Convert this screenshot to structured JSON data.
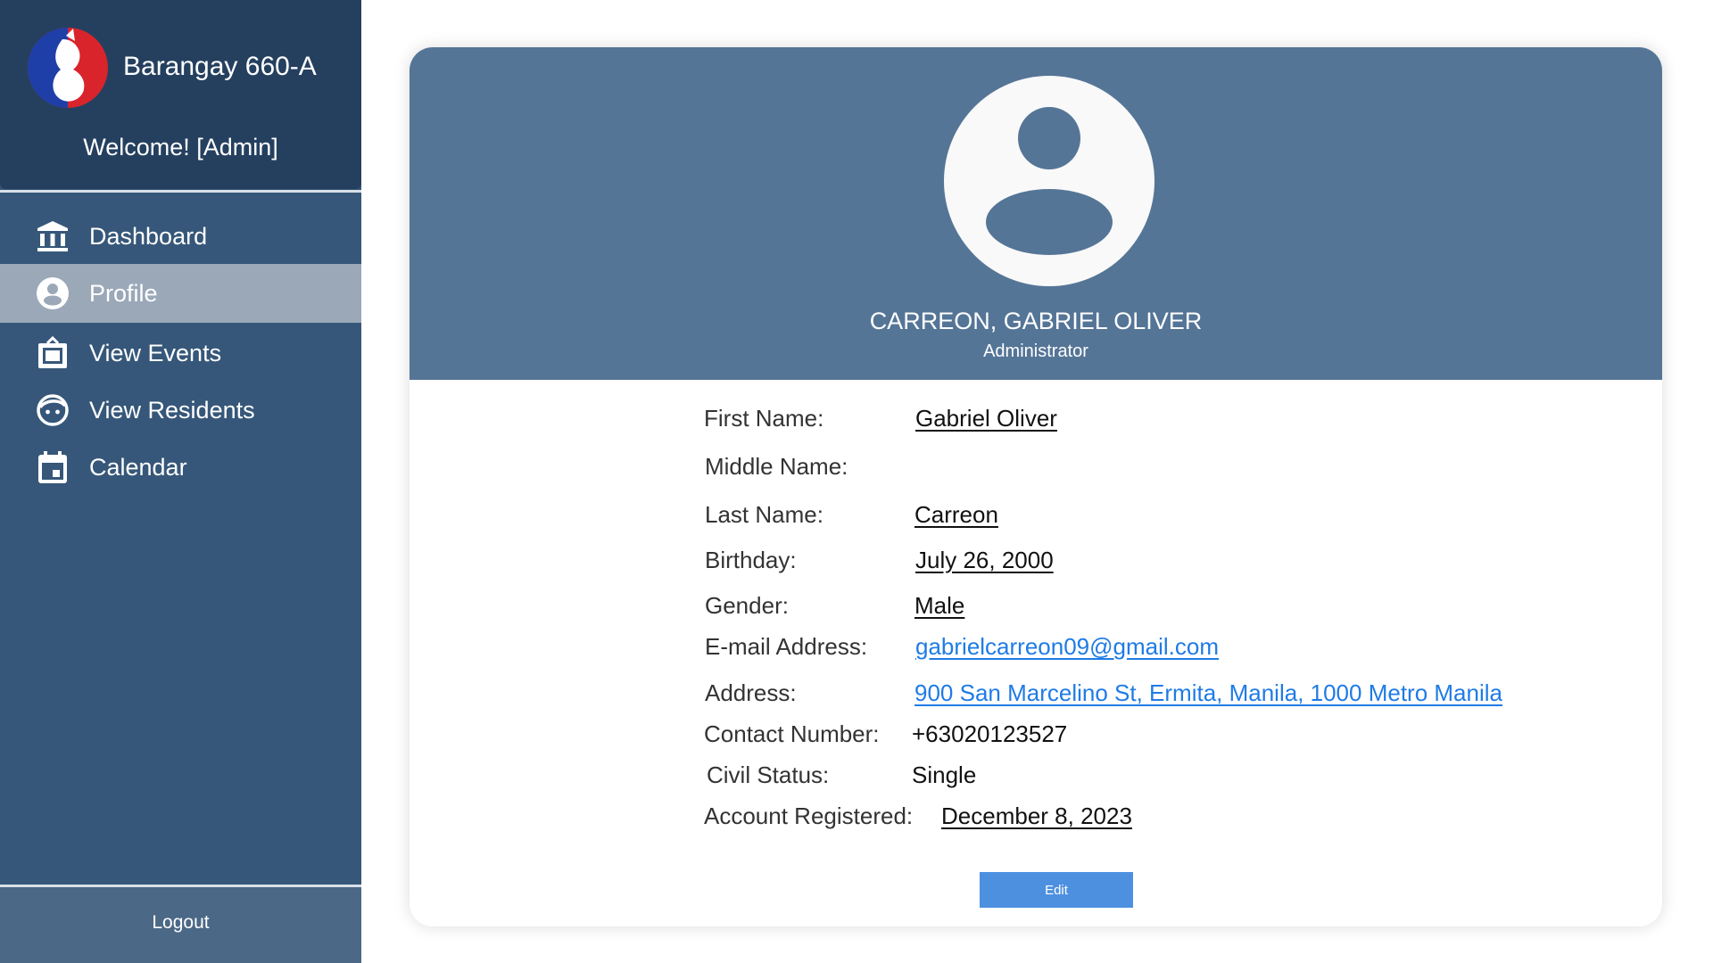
{
  "app": {
    "title": "Barangay 660-A",
    "welcome": "Welcome! [Admin]"
  },
  "sidebar": {
    "items": [
      {
        "label": "Dashboard",
        "icon": "bank-icon"
      },
      {
        "label": "Profile",
        "icon": "user-circle-icon",
        "active": true
      },
      {
        "label": "View Events",
        "icon": "frame-icon"
      },
      {
        "label": "View Residents",
        "icon": "face-icon"
      },
      {
        "label": "Calendar",
        "icon": "calendar-icon"
      }
    ],
    "logout": "Logout"
  },
  "profile": {
    "name": "CARREON, GABRIEL OLIVER",
    "role": "Administrator",
    "fields": {
      "first_name": {
        "label": "First Name:",
        "value": "Gabriel Oliver"
      },
      "middle_name": {
        "label": "Middle Name:",
        "value": ""
      },
      "last_name": {
        "label": "Last Name:",
        "value": "Carreon"
      },
      "birthday": {
        "label": "Birthday:",
        "value": "July 26, 2000"
      },
      "gender": {
        "label": "Gender:",
        "value": "Male"
      },
      "email": {
        "label": "E-mail Address:",
        "value": "gabrielcarreon09@gmail.com"
      },
      "address": {
        "label": "Address:",
        "value": "900 San Marcelino St, Ermita, Manila, 1000 Metro Manila"
      },
      "contact": {
        "label": "Contact Number:",
        "value": "+63020123527"
      },
      "civil_status": {
        "label": "Civil Status:",
        "value": "Single"
      },
      "registered": {
        "label": "Account Registered:",
        "value": "December 8, 2023"
      }
    },
    "edit_label": "Edit"
  },
  "colors": {
    "sidebar_bg": "#365779",
    "brand_bg": "#25405f",
    "active_item_bg": "#9aa8b8",
    "header_bg": "#557597",
    "link": "#1f7be6",
    "button": "#4d90e0",
    "logo_blue": "#1f3fa8",
    "logo_red": "#d9242c"
  }
}
